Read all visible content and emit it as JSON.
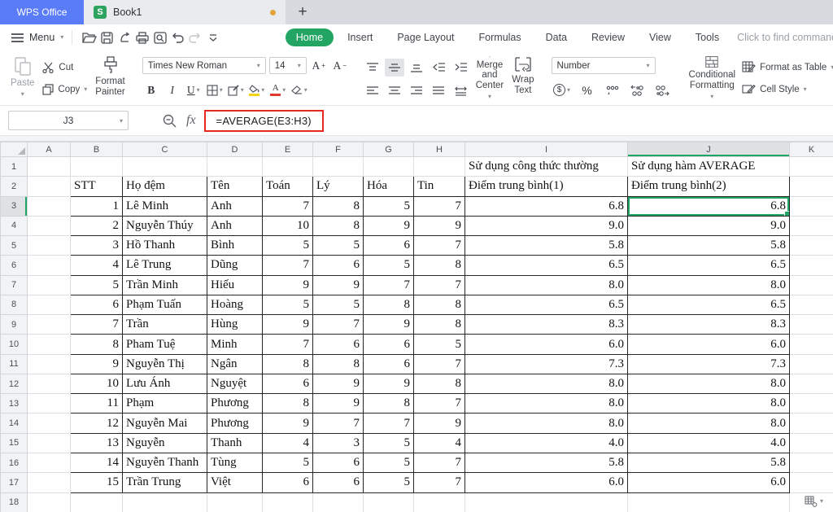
{
  "window": {
    "app_tab": "WPS Office",
    "document_tab": "Book1",
    "unsaved_indicator": true,
    "new_tab_glyph": "+"
  },
  "menu": {
    "label": "Menu"
  },
  "quickbar_icons": [
    "open-icon",
    "save-icon",
    "export-icon",
    "print-icon",
    "print-preview-icon",
    "undo-icon",
    "redo-icon",
    "more-icon"
  ],
  "ribbon_tabs": [
    {
      "label": "Home",
      "active": true
    },
    {
      "label": "Insert",
      "active": false
    },
    {
      "label": "Page Layout",
      "active": false
    },
    {
      "label": "Formulas",
      "active": false
    },
    {
      "label": "Data",
      "active": false
    },
    {
      "label": "Review",
      "active": false
    },
    {
      "label": "View",
      "active": false
    },
    {
      "label": "Tools",
      "active": false
    }
  ],
  "search": {
    "placeholder": "Click to find commands"
  },
  "ribbon": {
    "paste": "Paste",
    "cut": "Cut",
    "copy": "Copy",
    "format_painter": "Format Painter",
    "font_name": "Times New Roman",
    "font_size": "14",
    "merge_center": "Merge and Center",
    "wrap_text": "Wrap Text",
    "number_format": "Number",
    "conditional_formatting": "Conditional Formatting",
    "format_as_table": "Format as Table",
    "cell_style": "Cell Style"
  },
  "icons": {
    "bold": "B",
    "italic": "I",
    "underline": "U",
    "font_color": "A",
    "font_grow": "A",
    "font_shrink": "A",
    "fx": "fx",
    "currency": "$",
    "percent": "%"
  },
  "formula_bar": {
    "cell_ref": "J3",
    "formula": "=AVERAGE(E3:H3)"
  },
  "colors": {
    "accent_green": "#21a567",
    "brand_blue": "#5b7cf9",
    "annotation_red": "#e8281e",
    "unsaved_orange": "#e6a23c"
  },
  "sheet": {
    "col_headers": [
      "A",
      "B",
      "C",
      "D",
      "E",
      "F",
      "G",
      "H",
      "I",
      "J",
      "K"
    ],
    "row_count": 18,
    "selected_cell": "J3",
    "selected_col": "J",
    "selected_row": 3,
    "banner": [
      "Sử dụng công thức thường",
      "Sử dụng hàm AVERAGE"
    ],
    "headers": [
      "STT",
      "Họ đệm",
      "Tên",
      "Toán",
      "Lý",
      "Hóa",
      "Tin",
      "Điểm trung bình(1)",
      "Điểm trung bình(2)"
    ],
    "rows": [
      [
        1,
        "Lê Minh",
        "Anh",
        7,
        8,
        5,
        7,
        "6.8",
        "6.8"
      ],
      [
        2,
        "Nguyễn Thúy",
        "Anh",
        10,
        8,
        9,
        9,
        "9.0",
        "9.0"
      ],
      [
        3,
        "Hồ Thanh",
        "Bình",
        5,
        5,
        6,
        7,
        "5.8",
        "5.8"
      ],
      [
        4,
        "Lê Trung",
        "Dũng",
        7,
        6,
        5,
        8,
        "6.5",
        "6.5"
      ],
      [
        5,
        "Trần Minh",
        "Hiếu",
        9,
        9,
        7,
        7,
        "8.0",
        "8.0"
      ],
      [
        6,
        "Phạm Tuấn",
        "Hoàng",
        5,
        5,
        8,
        8,
        "6.5",
        "6.5"
      ],
      [
        7,
        "Trần",
        "Hùng",
        9,
        7,
        9,
        8,
        "8.3",
        "8.3"
      ],
      [
        8,
        "Pham Tuệ",
        "Minh",
        7,
        6,
        6,
        5,
        "6.0",
        "6.0"
      ],
      [
        9,
        "Nguyễn Thị",
        "Ngân",
        8,
        8,
        6,
        7,
        "7.3",
        "7.3"
      ],
      [
        10,
        "Lưu Ánh",
        "Nguyệt",
        6,
        9,
        9,
        8,
        "8.0",
        "8.0"
      ],
      [
        11,
        "Phạm",
        "Phương",
        8,
        9,
        8,
        7,
        "8.0",
        "8.0"
      ],
      [
        12,
        "Nguyễn Mai",
        "Phương",
        9,
        7,
        7,
        9,
        "8.0",
        "8.0"
      ],
      [
        13,
        "Nguyễn",
        "Thanh",
        4,
        3,
        5,
        4,
        "4.0",
        "4.0"
      ],
      [
        14,
        "Nguyễn Thanh",
        "Tùng",
        5,
        6,
        5,
        7,
        "5.8",
        "5.8"
      ],
      [
        15,
        "Trần Trung",
        "Việt",
        6,
        6,
        5,
        7,
        "6.0",
        "6.0"
      ]
    ]
  }
}
